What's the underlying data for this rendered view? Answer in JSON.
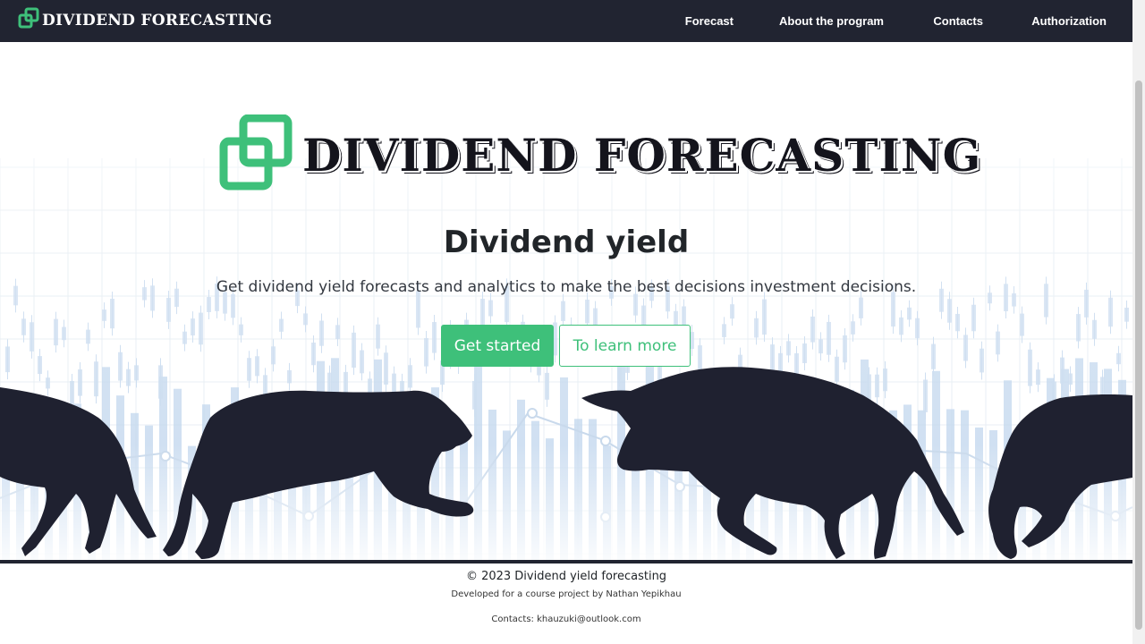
{
  "nav": {
    "brand": "DIVIDEND FORECASTING",
    "links": [
      {
        "label": "Forecast"
      },
      {
        "label": "About the program"
      },
      {
        "label": "Contacts"
      },
      {
        "label": "Authorization"
      }
    ]
  },
  "hero": {
    "logo_text": "DIVIDEND FORECASTING",
    "title": "Dividend yield",
    "subtitle": "Get dividend yield forecasts and analytics to make the best decisions investment decisions.",
    "primary_button": "Get started",
    "secondary_button": "To learn more"
  },
  "footer": {
    "copyright": "© 2023 Dividend yield forecasting",
    "developer": "Developed for a course project by Nathan Yepikhau",
    "contacts": "Contacts: khauzuki@outlook.com"
  },
  "colors": {
    "navbar": "#212431",
    "accent": "#3ec07a",
    "silhouette": "#1f2130",
    "chart_bars": "#b9d1ea"
  },
  "icons": {
    "logo": "interlocked-squares-logo-icon"
  }
}
